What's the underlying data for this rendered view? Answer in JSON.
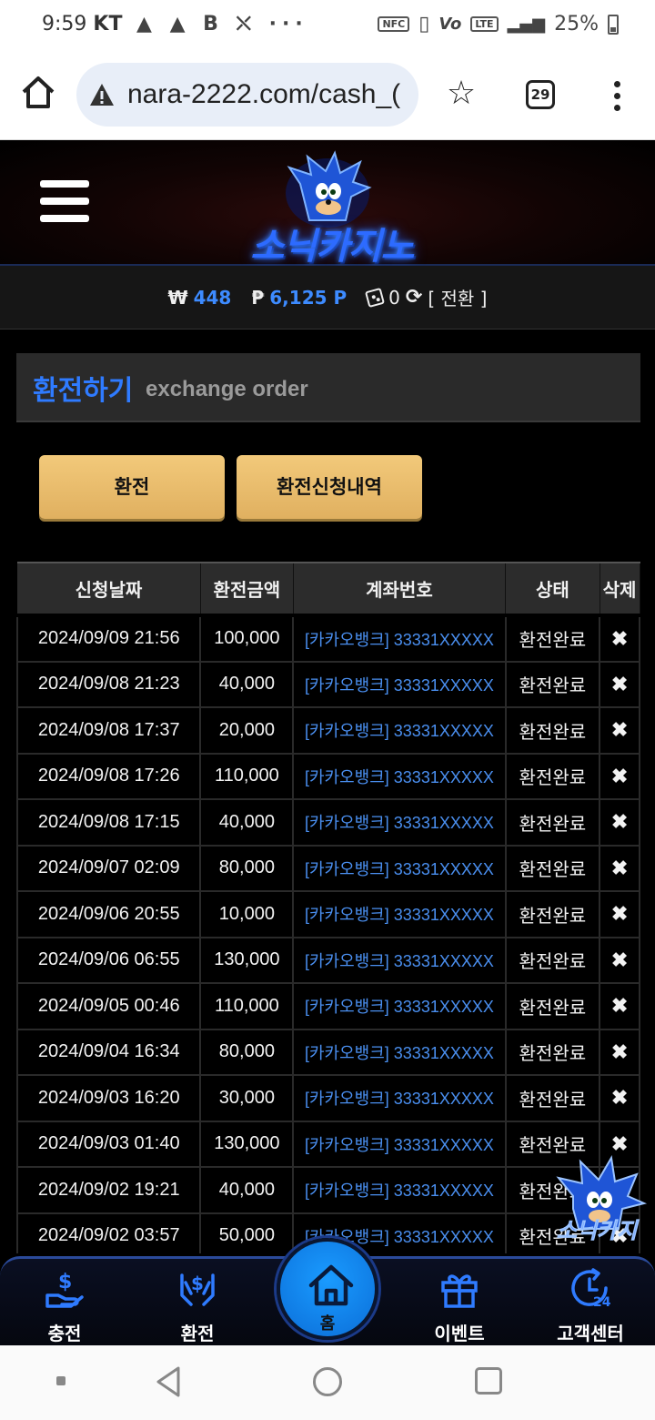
{
  "status_bar": {
    "time": "9:59",
    "carrier": "KT",
    "left_icons": "▲ ▲ B ⛌ ···",
    "battery": "25%",
    "chips": [
      "NFC",
      "LTE"
    ]
  },
  "browser": {
    "url": "nara-2222.com/cash_(",
    "tab_count": "29"
  },
  "site": {
    "logo_text": "소닉카지노"
  },
  "balance": {
    "won_symbol": "₩",
    "won_value": "448",
    "point_symbol": "₱",
    "point_value": "6,125 P",
    "chip_value": "0",
    "convert_label": "[ 전환 ]"
  },
  "section": {
    "title_ko": "환전하기",
    "title_en": "exchange order"
  },
  "buttons": {
    "exchange": "환전",
    "history": "환전신청내역"
  },
  "table": {
    "headers": [
      "신청날짜",
      "환전금액",
      "계좌번호",
      "상태",
      "삭제"
    ],
    "rows": [
      {
        "date": "2024/09/09 21:56",
        "amount": "100,000",
        "account": "[카카오뱅크] 33331XXXXX",
        "status": "환전완료",
        "del": "✖"
      },
      {
        "date": "2024/09/08 21:23",
        "amount": "40,000",
        "account": "[카카오뱅크] 33331XXXXX",
        "status": "환전완료",
        "del": "✖"
      },
      {
        "date": "2024/09/08 17:37",
        "amount": "20,000",
        "account": "[카카오뱅크] 33331XXXXX",
        "status": "환전완료",
        "del": "✖"
      },
      {
        "date": "2024/09/08 17:26",
        "amount": "110,000",
        "account": "[카카오뱅크] 33331XXXXX",
        "status": "환전완료",
        "del": "✖"
      },
      {
        "date": "2024/09/08 17:15",
        "amount": "40,000",
        "account": "[카카오뱅크] 33331XXXXX",
        "status": "환전완료",
        "del": "✖"
      },
      {
        "date": "2024/09/07 02:09",
        "amount": "80,000",
        "account": "[카카오뱅크] 33331XXXXX",
        "status": "환전완료",
        "del": "✖"
      },
      {
        "date": "2024/09/06 20:55",
        "amount": "10,000",
        "account": "[카카오뱅크] 33331XXXXX",
        "status": "환전완료",
        "del": "✖"
      },
      {
        "date": "2024/09/06 06:55",
        "amount": "130,000",
        "account": "[카카오뱅크] 33331XXXXX",
        "status": "환전완료",
        "del": "✖"
      },
      {
        "date": "2024/09/05 00:46",
        "amount": "110,000",
        "account": "[카카오뱅크] 33331XXXXX",
        "status": "환전완료",
        "del": "✖"
      },
      {
        "date": "2024/09/04 16:34",
        "amount": "80,000",
        "account": "[카카오뱅크] 33331XXXXX",
        "status": "환전완료",
        "del": "✖"
      },
      {
        "date": "2024/09/03 16:20",
        "amount": "30,000",
        "account": "[카카오뱅크] 33331XXXXX",
        "status": "환전완료",
        "del": "✖"
      },
      {
        "date": "2024/09/03 01:40",
        "amount": "130,000",
        "account": "[카카오뱅크] 33331XXXXX",
        "status": "환전완료",
        "del": "✖"
      },
      {
        "date": "2024/09/02 19:21",
        "amount": "40,000",
        "account": "[카카오뱅크] 33331XXXXX",
        "status": "환전완료",
        "del": "✖"
      },
      {
        "date": "2024/09/02 03:57",
        "amount": "50,000",
        "account": "[카카오뱅크] 33331XXXXX",
        "status": "환전완료",
        "del": "✖"
      }
    ]
  },
  "bottom_nav": {
    "charge": "충전",
    "exchange": "환전",
    "home": "홈",
    "event": "이벤트",
    "support": "고객센터",
    "support_badge": "24"
  },
  "colors": {
    "accent_blue": "#2f7bff",
    "gold_button": "#e8bd6e",
    "background": "#000000"
  },
  "icons": [
    "home-icon",
    "warning-icon",
    "star-icon",
    "tabs-icon",
    "overflow-menu-icon",
    "hamburger-icon",
    "dice-icon",
    "refresh-icon",
    "delete-icon",
    "charge-icon",
    "exchange-icon",
    "gift-icon",
    "support-24-icon"
  ]
}
